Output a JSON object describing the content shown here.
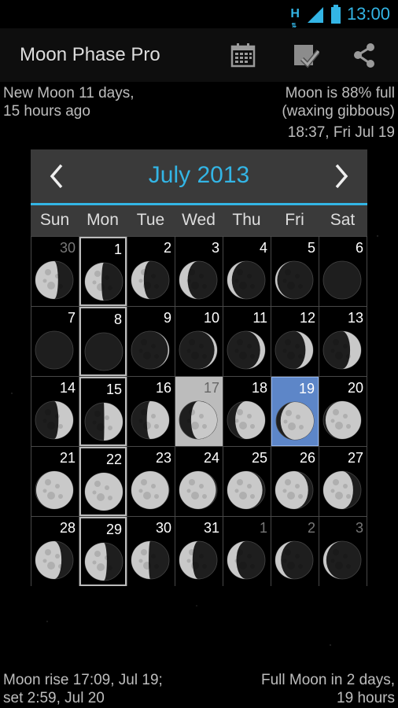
{
  "status": {
    "network": "H",
    "time": "13:00"
  },
  "app": {
    "title": "Moon Phase Pro"
  },
  "info": {
    "top_left": [
      "New Moon 11 days,",
      "15 hours ago"
    ],
    "top_right": [
      "Moon is 88% full",
      "(waxing gibbous)",
      "18:37, Fri Jul 19"
    ],
    "bottom_left": [
      "Moon rise 17:09, Jul 19;",
      "set 2:59, Jul 20"
    ],
    "bottom_right": [
      "Full Moon in 2 days,",
      "19 hours"
    ]
  },
  "calendar": {
    "month_label": "July 2013",
    "weekdays": [
      "Sun",
      "Mon",
      "Tue",
      "Wed",
      "Thu",
      "Fri",
      "Sat"
    ],
    "weeks": [
      [
        {
          "d": "30",
          "f": 0.6,
          "w": -1,
          "o": 1
        },
        {
          "d": "1",
          "f": 0.44,
          "w": -1
        },
        {
          "d": "2",
          "f": 0.33,
          "w": -1
        },
        {
          "d": "3",
          "f": 0.22,
          "w": -1
        },
        {
          "d": "4",
          "f": 0.12,
          "w": -1
        },
        {
          "d": "5",
          "f": 0.05,
          "w": -1
        },
        {
          "d": "6",
          "f": 0.01,
          "w": -1
        }
      ],
      [
        {
          "d": "7",
          "f": 0.0,
          "w": 1
        },
        {
          "d": "8",
          "f": 0.0,
          "w": 1
        },
        {
          "d": "9",
          "f": 0.03,
          "w": 1
        },
        {
          "d": "10",
          "f": 0.07,
          "w": 1
        },
        {
          "d": "11",
          "f": 0.13,
          "w": 1
        },
        {
          "d": "12",
          "f": 0.2,
          "w": 1
        },
        {
          "d": "13",
          "f": 0.29,
          "w": 1
        }
      ],
      [
        {
          "d": "14",
          "f": 0.39,
          "w": 1
        },
        {
          "d": "15",
          "f": 0.49,
          "w": 1
        },
        {
          "d": "16",
          "f": 0.59,
          "w": 1
        },
        {
          "d": "17",
          "f": 0.69,
          "w": 1,
          "t": 1
        },
        {
          "d": "18",
          "f": 0.79,
          "w": 1
        },
        {
          "d": "19",
          "f": 0.88,
          "w": 1,
          "s": 1
        },
        {
          "d": "20",
          "f": 0.94,
          "w": 1
        }
      ],
      [
        {
          "d": "21",
          "f": 0.98,
          "w": 1
        },
        {
          "d": "22",
          "f": 1.0,
          "w": 1
        },
        {
          "d": "23",
          "f": 0.99,
          "w": -1
        },
        {
          "d": "24",
          "f": 0.97,
          "w": -1
        },
        {
          "d": "25",
          "f": 0.93,
          "w": -1
        },
        {
          "d": "26",
          "f": 0.87,
          "w": -1
        },
        {
          "d": "27",
          "f": 0.79,
          "w": -1
        }
      ],
      [
        {
          "d": "28",
          "f": 0.69,
          "w": -1
        },
        {
          "d": "29",
          "f": 0.58,
          "w": -1
        },
        {
          "d": "30",
          "f": 0.46,
          "w": -1
        },
        {
          "d": "31",
          "f": 0.35,
          "w": -1
        },
        {
          "d": "1",
          "f": 0.24,
          "w": -1,
          "o": 1
        },
        {
          "d": "2",
          "f": 0.15,
          "w": -1,
          "o": 1
        },
        {
          "d": "3",
          "f": 0.08,
          "w": -1,
          "o": 1
        }
      ]
    ]
  },
  "icons": {
    "calendar": "calendar-icon",
    "check": "check-icon",
    "share": "share-icon",
    "prev": "chevron-left-icon",
    "next": "chevron-right-icon"
  },
  "colors": {
    "accent": "#33b5e5",
    "selected": "#5d86c8",
    "today": "#bcbcbc"
  }
}
